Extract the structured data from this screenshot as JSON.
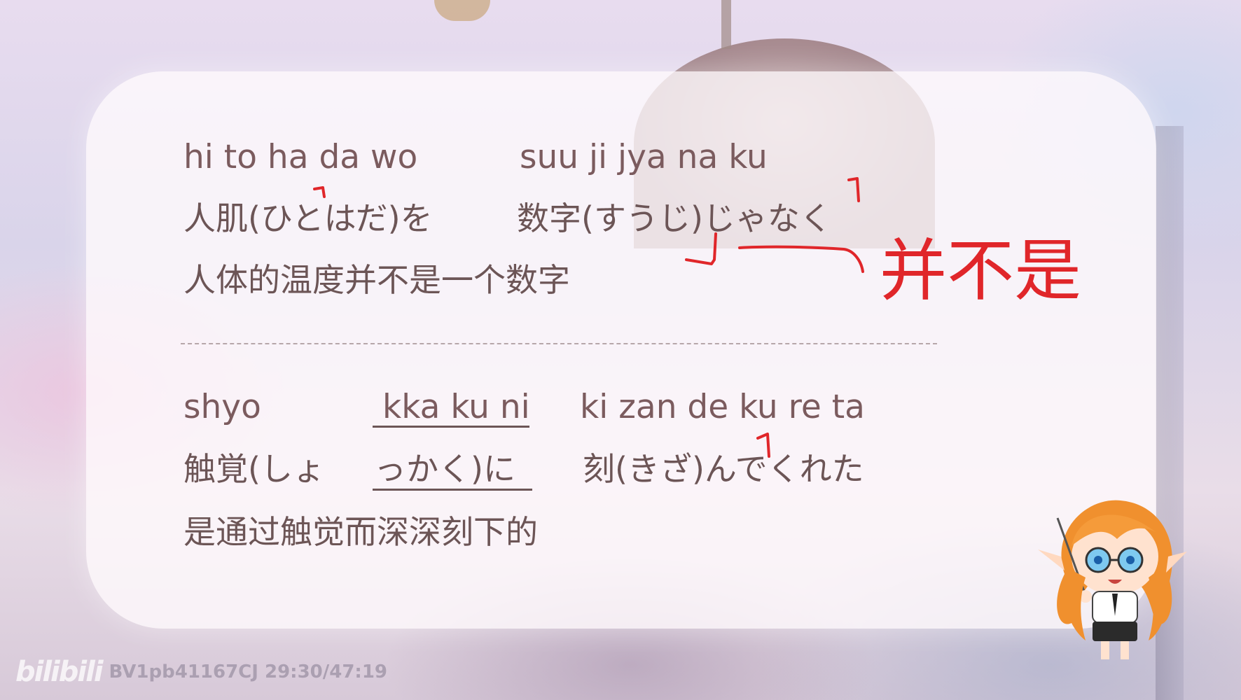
{
  "lesson": {
    "block1": {
      "romaji_a": "hi to ha da wo",
      "romaji_b": "suu ji jya na ku",
      "japanese_a": "人肌(ひとはだ)を",
      "japanese_b": "数字(すうじ)じゃなく",
      "chinese": "人体的温度并不是一个数字"
    },
    "block2": {
      "romaji_a": "shyo",
      "romaji_b": "kka ku ni",
      "romaji_c": "ki zan de ku re ta",
      "japanese_a": "触覚(しょ",
      "japanese_b": "っかく)に",
      "japanese_c": "刻(きざ)んでくれた",
      "chinese": "是通过触觉而深深刻下的"
    }
  },
  "annotation": {
    "handwritten_note": "并不是",
    "ink_color": "#e0262a"
  },
  "watermark": {
    "logo": "bilibili",
    "video_info": "BV1pb41167CJ 29:30/47:19"
  },
  "colors": {
    "text": "#6c5556",
    "card": "#fffafc"
  },
  "icons": {
    "mascot": "teacher-mascot-icon"
  }
}
